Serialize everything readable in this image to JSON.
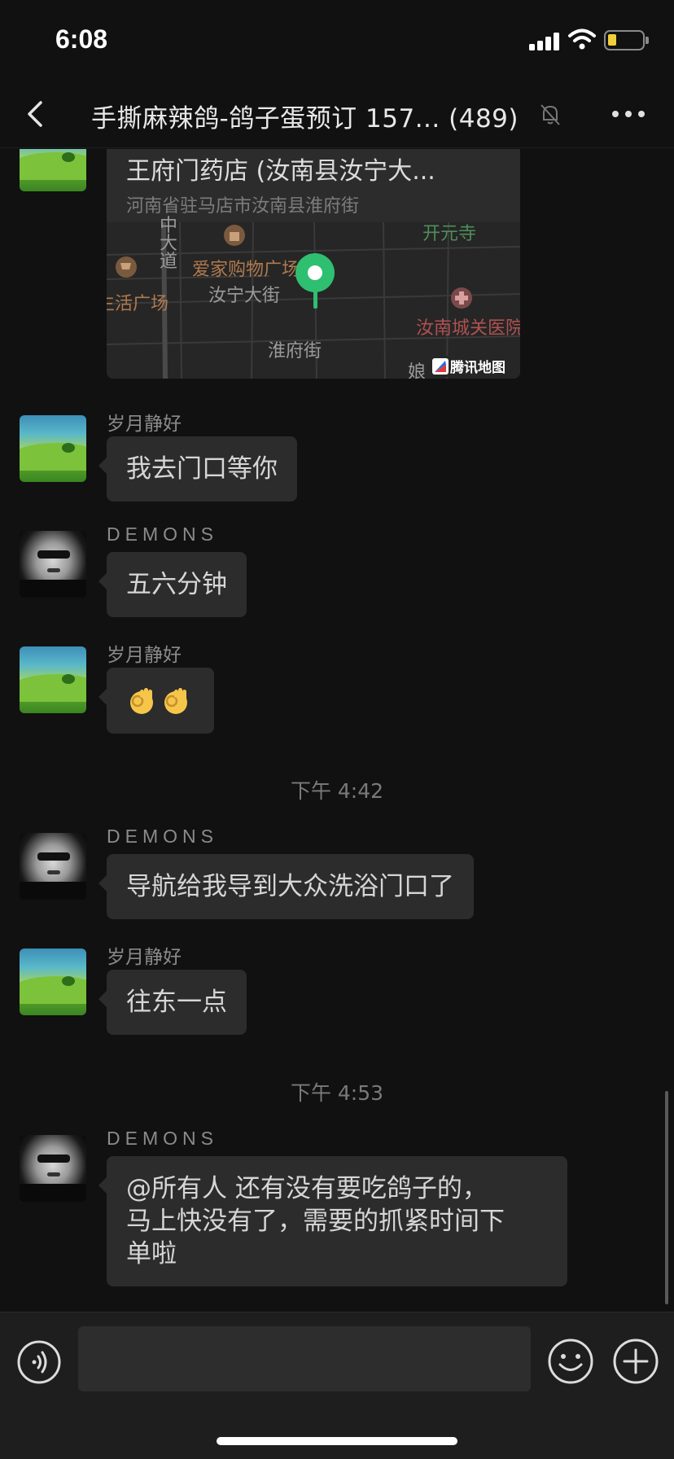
{
  "status": {
    "time": "6:08"
  },
  "header": {
    "title": "手撕麻辣鸽-鸽子蛋预订 157... (489)"
  },
  "location": {
    "name": "王府门药店 (汝南县汝宁大...",
    "address": "河南省驻马店市汝南县淮府街",
    "map_labels": {
      "vertical": "中大道",
      "kaiyuan": "开元寺",
      "aijia": "爱家购物广场",
      "rurning": "汝宁大街",
      "shenghuo": "生活广场",
      "hospital": "汝南城关医院",
      "huaifu": "淮府街",
      "niang": "娘",
      "brand": "腾讯地图"
    }
  },
  "messages": [
    {
      "sender": "岁月静好",
      "text": "我去门口等你"
    },
    {
      "sender": "DEMONS",
      "text": "五六分钟"
    },
    {
      "sender": "岁月静好",
      "emoji": "ok-hand ok-hand"
    },
    {
      "timestamp": "下午 4:42"
    },
    {
      "sender": "DEMONS",
      "text": "导航给我导到大众洗浴门口了"
    },
    {
      "sender": "岁月静好",
      "text": "往东一点"
    },
    {
      "timestamp": "下午 4:53"
    },
    {
      "sender": "DEMONS",
      "text": "@所有人 还有没有要吃鸽子的，马上快没有了，需要的抓紧时间下单啦"
    }
  ],
  "labels": {
    "timestamp_1": "下午 4:42",
    "timestamp_2": "下午 4:53",
    "sender_a": "岁月静好",
    "sender_b": "DEMONS",
    "msg_1": "我去门口等你",
    "msg_2": "五六分钟",
    "msg_4": "导航给我导到大众洗浴门口了",
    "msg_5": "往东一点",
    "msg_6_line1": "@所有人 还有没有要吃鸽子的，",
    "msg_6_line2": "马上快没有了，需要的抓紧时间下",
    "msg_6_line3": "单啦"
  },
  "icons": {
    "back": "chevron-left-icon",
    "mute": "bell-slash-icon",
    "more": "ellipsis-icon",
    "voice": "voice-icon",
    "emoji": "smile-icon",
    "plus": "plus-icon",
    "pin": "map-pin-icon"
  },
  "colors": {
    "background": "#111111",
    "bubble": "#2c2c2c",
    "pin": "#2fbf71"
  }
}
